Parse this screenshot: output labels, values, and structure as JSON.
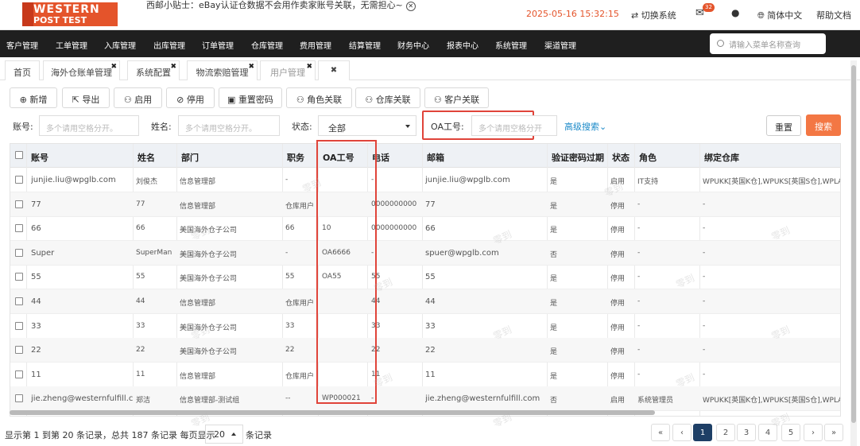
{
  "header": {
    "logo_line1": "WESTERN",
    "logo_line2": "POST TEST",
    "notice": "西邮小贴士：eBay认证仓数据不会用作卖家账号关联，无需担心~",
    "datetime": "2025-05-16 15:32:15",
    "switch_system": "切换系统",
    "mail_badge": "32",
    "language": "简体中文",
    "help": "帮助文档"
  },
  "nav": {
    "items": [
      "客户管理",
      "工单管理",
      "入库管理",
      "出库管理",
      "订单管理",
      "仓库管理",
      "费用管理",
      "结算管理",
      "财务中心",
      "报表中心",
      "系统管理",
      "渠道管理"
    ],
    "search_placeholder": "请输入菜单名称查询"
  },
  "tabs": [
    {
      "label": "首页"
    },
    {
      "label": "海外仓账单管理"
    },
    {
      "label": "系统配置"
    },
    {
      "label": "物流索赔管理"
    },
    {
      "label": "用户管理"
    }
  ],
  "toolbar": [
    "新增",
    "导出",
    "启用",
    "停用",
    "重置密码",
    "角色关联",
    "仓库关联",
    "客户关联"
  ],
  "filters": {
    "account_label": "账号:",
    "account_placeholder": "多个请用空格分开。",
    "name_label": "姓名:",
    "name_placeholder": "多个请用空格分开。",
    "status_label": "状态:",
    "status_value": "全部",
    "oa_label": "OA工号:",
    "oa_placeholder": "多个请用空格分开",
    "advanced": "高级搜索",
    "reset": "重置",
    "search": "搜索"
  },
  "table": {
    "columns": [
      "账号",
      "姓名",
      "部门",
      "职务",
      "OA工号",
      "电话",
      "邮箱",
      "验证密码过期",
      "状态",
      "角色",
      "绑定仓库"
    ],
    "rows": [
      [
        "junjie.liu@wpglb.com",
        "刘俊杰",
        "信息管理部",
        "-",
        "",
        "-",
        "junjie.liu@wpglb.com",
        "是",
        "启用",
        "IT支持",
        "WPUKK[英国K仓],WPUKS[英国S仓],WPLA"
      ],
      [
        "77",
        "77",
        "信息管理部",
        "仓库用户",
        "",
        "0000000000",
        "77",
        "是",
        "停用",
        "-",
        "-"
      ],
      [
        "66",
        "66",
        "美国海外仓子公司",
        "66",
        "10",
        "0000000000",
        "66",
        "是",
        "停用",
        "-",
        "-"
      ],
      [
        "Super",
        "SuperMan",
        "美国海外仓子公司",
        "-",
        "OA6666",
        "-",
        "spuer@wpglb.com",
        "否",
        "停用",
        "-",
        "-"
      ],
      [
        "55",
        "55",
        "美国海外仓子公司",
        "55",
        "OA55",
        "55",
        "55",
        "是",
        "停用",
        "-",
        "-"
      ],
      [
        "44",
        "44",
        "信息管理部",
        "仓库用户",
        "",
        "44",
        "44",
        "是",
        "停用",
        "-",
        "-"
      ],
      [
        "33",
        "33",
        "美国海外仓子公司",
        "33",
        "",
        "33",
        "33",
        "是",
        "停用",
        "-",
        "-"
      ],
      [
        "22",
        "22",
        "美国海外仓子公司",
        "22",
        "",
        "22",
        "22",
        "是",
        "停用",
        "-",
        "-"
      ],
      [
        "11",
        "11",
        "信息管理部",
        "仓库用户",
        "",
        "11",
        "11",
        "是",
        "停用",
        "-",
        "-"
      ],
      [
        "jie.zheng@westernfulfill.com",
        "郑洁",
        "信息管理部-测试组",
        "--",
        "WP000021",
        "-",
        "jie.zheng@westernfulfill.com",
        "否",
        "启用",
        "系统管理员",
        "WPUKK[英国K仓],WPUKS[英国S仓],WPLA"
      ]
    ]
  },
  "footer": {
    "text_before": "显示第 1 到第 20 条记录，总共 187 条记录 每页显示",
    "page_size": "20",
    "text_after": "条记录",
    "pages": [
      "«",
      "‹",
      "1",
      "2",
      "3",
      "4",
      "5",
      "›",
      "»"
    ]
  },
  "watermark": "零到"
}
